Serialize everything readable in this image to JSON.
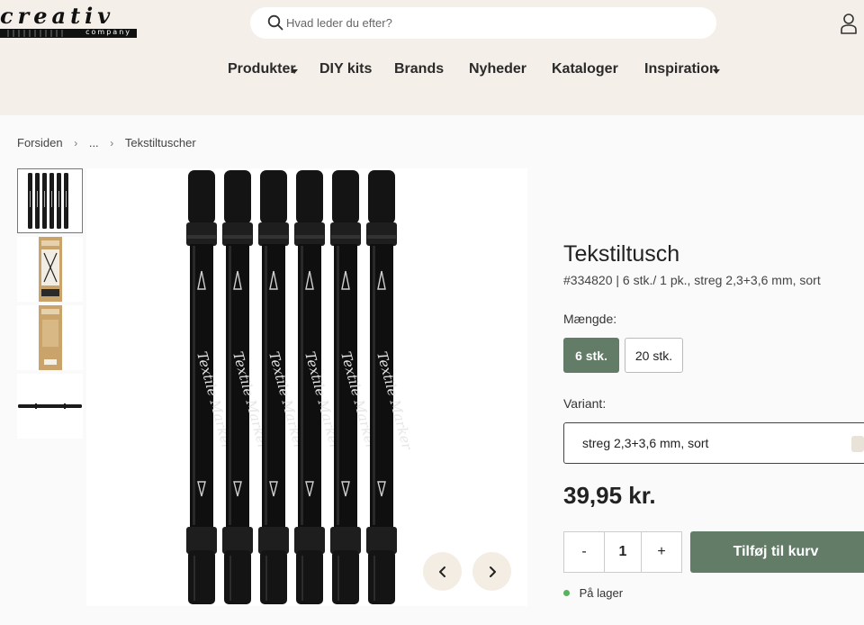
{
  "brand": {
    "logo_word": "creativ",
    "logo_sub": "company"
  },
  "search": {
    "placeholder": "Hvad leder du efter?"
  },
  "nav": {
    "items": [
      {
        "label": "Produkter",
        "has_dropdown": true
      },
      {
        "label": "DIY kits",
        "has_dropdown": false
      },
      {
        "label": "Brands",
        "has_dropdown": false
      },
      {
        "label": "Nyheder",
        "has_dropdown": false
      },
      {
        "label": "Kataloger",
        "has_dropdown": false
      },
      {
        "label": "Inspiration",
        "has_dropdown": true
      }
    ]
  },
  "breadcrumb": {
    "items": [
      "Forsiden",
      "...",
      "Tekstiltuscher"
    ]
  },
  "gallery": {
    "pen_text": "Textile Marker",
    "pen_count": 6,
    "thumbnail_count": 4
  },
  "product": {
    "title": "Tekstiltusch",
    "subtitle": "#334820  | 6 stk./ 1 pk., streg 2,3+3,6 mm, sort",
    "quantity_label": "Mængde:",
    "quantity_options": [
      "6 stk.",
      "20 stk."
    ],
    "quantity_selected": "6 stk.",
    "variant_label": "Variant:",
    "variant_value": "streg 2,3+3,6 mm, sort",
    "price": "39,95 kr.",
    "qty_minus": "-",
    "qty_value": "1",
    "qty_plus": "+",
    "add_to_cart": "Tilføj til kurv",
    "stock_status": "På lager"
  },
  "colors": {
    "header_bg": "#f4efe8",
    "accent_green": "#627c68",
    "stock_green": "#58b35e",
    "gallery_button_bg": "#f4ede3"
  }
}
